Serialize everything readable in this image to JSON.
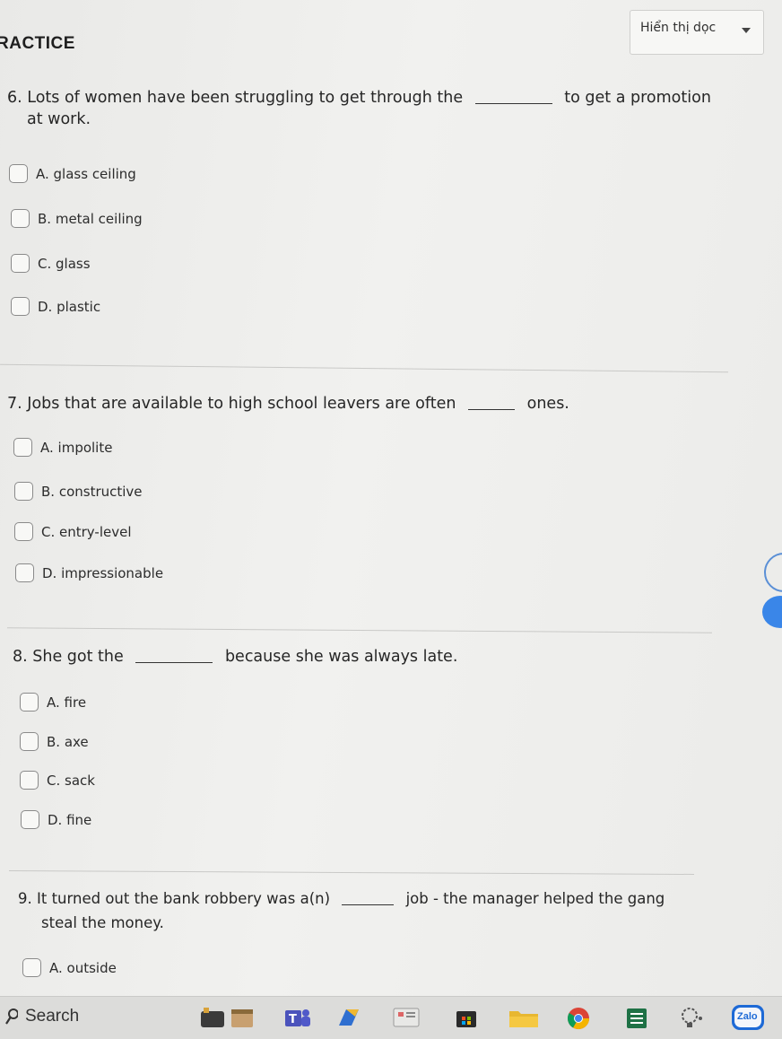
{
  "header": {
    "title": "RACTICE",
    "view_select": {
      "label": "Hiển thị dọc"
    }
  },
  "questions": [
    {
      "number": "6.",
      "text_before": "Lots of women have been struggling to get through the",
      "text_after": "to get a promotion",
      "text_line2": "at work.",
      "options": [
        "A. glass ceiling",
        "B. metal ceiling",
        "C. glass",
        "D. plastic"
      ]
    },
    {
      "number": "7.",
      "text_before": "Jobs that are available to high school leavers are often",
      "text_after": "ones.",
      "options": [
        "A. impolite",
        "B. constructive",
        "C. entry-level",
        "D. impressionable"
      ]
    },
    {
      "number": "8.",
      "text_before": "She got the",
      "text_after": "because she was always late.",
      "options": [
        "A. fire",
        "B. axe",
        "C. sack",
        "D. fine"
      ]
    },
    {
      "number": "9.",
      "text_before": "It turned out the bank robbery was a(n)",
      "text_after": "job - the manager helped the gang",
      "text_line2": "steal the money.",
      "options": [
        "A. outside"
      ]
    }
  ],
  "taskbar": {
    "search_label": "Search",
    "icons": [
      "media-player-icon",
      "calendar-icon",
      "teams-icon",
      "app-icon",
      "news-icon",
      "store-icon",
      "folder-icon",
      "chrome-icon",
      "spreadsheet-icon",
      "tips-icon",
      "zalo-icon"
    ],
    "zalo_label": "Zalo"
  }
}
